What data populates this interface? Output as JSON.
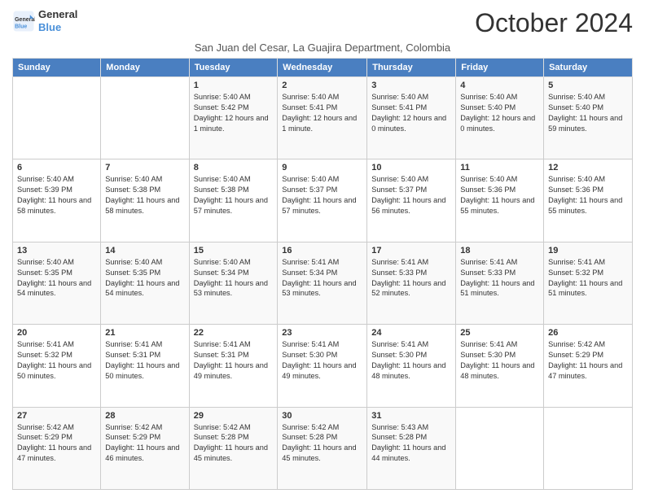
{
  "header": {
    "logo_line1": "General",
    "logo_line2": "Blue",
    "month_title": "October 2024",
    "subtitle": "San Juan del Cesar, La Guajira Department, Colombia"
  },
  "days_of_week": [
    "Sunday",
    "Monday",
    "Tuesday",
    "Wednesday",
    "Thursday",
    "Friday",
    "Saturday"
  ],
  "weeks": [
    [
      {
        "day": "",
        "sunrise": "",
        "sunset": "",
        "daylight": ""
      },
      {
        "day": "",
        "sunrise": "",
        "sunset": "",
        "daylight": ""
      },
      {
        "day": "1",
        "sunrise": "Sunrise: 5:40 AM",
        "sunset": "Sunset: 5:42 PM",
        "daylight": "Daylight: 12 hours and 1 minute."
      },
      {
        "day": "2",
        "sunrise": "Sunrise: 5:40 AM",
        "sunset": "Sunset: 5:41 PM",
        "daylight": "Daylight: 12 hours and 1 minute."
      },
      {
        "day": "3",
        "sunrise": "Sunrise: 5:40 AM",
        "sunset": "Sunset: 5:41 PM",
        "daylight": "Daylight: 12 hours and 0 minutes."
      },
      {
        "day": "4",
        "sunrise": "Sunrise: 5:40 AM",
        "sunset": "Sunset: 5:40 PM",
        "daylight": "Daylight: 12 hours and 0 minutes."
      },
      {
        "day": "5",
        "sunrise": "Sunrise: 5:40 AM",
        "sunset": "Sunset: 5:40 PM",
        "daylight": "Daylight: 11 hours and 59 minutes."
      }
    ],
    [
      {
        "day": "6",
        "sunrise": "Sunrise: 5:40 AM",
        "sunset": "Sunset: 5:39 PM",
        "daylight": "Daylight: 11 hours and 58 minutes."
      },
      {
        "day": "7",
        "sunrise": "Sunrise: 5:40 AM",
        "sunset": "Sunset: 5:38 PM",
        "daylight": "Daylight: 11 hours and 58 minutes."
      },
      {
        "day": "8",
        "sunrise": "Sunrise: 5:40 AM",
        "sunset": "Sunset: 5:38 PM",
        "daylight": "Daylight: 11 hours and 57 minutes."
      },
      {
        "day": "9",
        "sunrise": "Sunrise: 5:40 AM",
        "sunset": "Sunset: 5:37 PM",
        "daylight": "Daylight: 11 hours and 57 minutes."
      },
      {
        "day": "10",
        "sunrise": "Sunrise: 5:40 AM",
        "sunset": "Sunset: 5:37 PM",
        "daylight": "Daylight: 11 hours and 56 minutes."
      },
      {
        "day": "11",
        "sunrise": "Sunrise: 5:40 AM",
        "sunset": "Sunset: 5:36 PM",
        "daylight": "Daylight: 11 hours and 55 minutes."
      },
      {
        "day": "12",
        "sunrise": "Sunrise: 5:40 AM",
        "sunset": "Sunset: 5:36 PM",
        "daylight": "Daylight: 11 hours and 55 minutes."
      }
    ],
    [
      {
        "day": "13",
        "sunrise": "Sunrise: 5:40 AM",
        "sunset": "Sunset: 5:35 PM",
        "daylight": "Daylight: 11 hours and 54 minutes."
      },
      {
        "day": "14",
        "sunrise": "Sunrise: 5:40 AM",
        "sunset": "Sunset: 5:35 PM",
        "daylight": "Daylight: 11 hours and 54 minutes."
      },
      {
        "day": "15",
        "sunrise": "Sunrise: 5:40 AM",
        "sunset": "Sunset: 5:34 PM",
        "daylight": "Daylight: 11 hours and 53 minutes."
      },
      {
        "day": "16",
        "sunrise": "Sunrise: 5:41 AM",
        "sunset": "Sunset: 5:34 PM",
        "daylight": "Daylight: 11 hours and 53 minutes."
      },
      {
        "day": "17",
        "sunrise": "Sunrise: 5:41 AM",
        "sunset": "Sunset: 5:33 PM",
        "daylight": "Daylight: 11 hours and 52 minutes."
      },
      {
        "day": "18",
        "sunrise": "Sunrise: 5:41 AM",
        "sunset": "Sunset: 5:33 PM",
        "daylight": "Daylight: 11 hours and 51 minutes."
      },
      {
        "day": "19",
        "sunrise": "Sunrise: 5:41 AM",
        "sunset": "Sunset: 5:32 PM",
        "daylight": "Daylight: 11 hours and 51 minutes."
      }
    ],
    [
      {
        "day": "20",
        "sunrise": "Sunrise: 5:41 AM",
        "sunset": "Sunset: 5:32 PM",
        "daylight": "Daylight: 11 hours and 50 minutes."
      },
      {
        "day": "21",
        "sunrise": "Sunrise: 5:41 AM",
        "sunset": "Sunset: 5:31 PM",
        "daylight": "Daylight: 11 hours and 50 minutes."
      },
      {
        "day": "22",
        "sunrise": "Sunrise: 5:41 AM",
        "sunset": "Sunset: 5:31 PM",
        "daylight": "Daylight: 11 hours and 49 minutes."
      },
      {
        "day": "23",
        "sunrise": "Sunrise: 5:41 AM",
        "sunset": "Sunset: 5:30 PM",
        "daylight": "Daylight: 11 hours and 49 minutes."
      },
      {
        "day": "24",
        "sunrise": "Sunrise: 5:41 AM",
        "sunset": "Sunset: 5:30 PM",
        "daylight": "Daylight: 11 hours and 48 minutes."
      },
      {
        "day": "25",
        "sunrise": "Sunrise: 5:41 AM",
        "sunset": "Sunset: 5:30 PM",
        "daylight": "Daylight: 11 hours and 48 minutes."
      },
      {
        "day": "26",
        "sunrise": "Sunrise: 5:42 AM",
        "sunset": "Sunset: 5:29 PM",
        "daylight": "Daylight: 11 hours and 47 minutes."
      }
    ],
    [
      {
        "day": "27",
        "sunrise": "Sunrise: 5:42 AM",
        "sunset": "Sunset: 5:29 PM",
        "daylight": "Daylight: 11 hours and 47 minutes."
      },
      {
        "day": "28",
        "sunrise": "Sunrise: 5:42 AM",
        "sunset": "Sunset: 5:29 PM",
        "daylight": "Daylight: 11 hours and 46 minutes."
      },
      {
        "day": "29",
        "sunrise": "Sunrise: 5:42 AM",
        "sunset": "Sunset: 5:28 PM",
        "daylight": "Daylight: 11 hours and 45 minutes."
      },
      {
        "day": "30",
        "sunrise": "Sunrise: 5:42 AM",
        "sunset": "Sunset: 5:28 PM",
        "daylight": "Daylight: 11 hours and 45 minutes."
      },
      {
        "day": "31",
        "sunrise": "Sunrise: 5:43 AM",
        "sunset": "Sunset: 5:28 PM",
        "daylight": "Daylight: 11 hours and 44 minutes."
      },
      {
        "day": "",
        "sunrise": "",
        "sunset": "",
        "daylight": ""
      },
      {
        "day": "",
        "sunrise": "",
        "sunset": "",
        "daylight": ""
      }
    ]
  ]
}
